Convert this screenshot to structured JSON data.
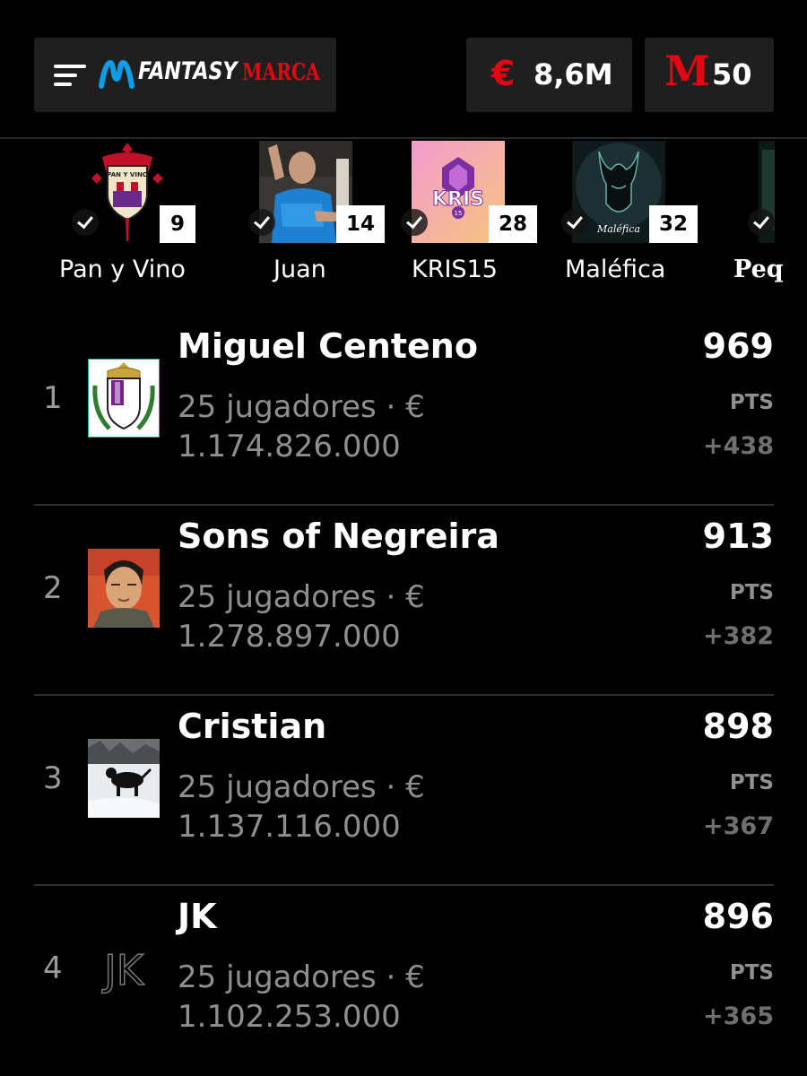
{
  "header": {
    "brand": {
      "fantasy": "FANTASY",
      "marca": "MARCA"
    },
    "money": {
      "icon": "euro-icon",
      "value": "8,6M"
    },
    "points": {
      "icon": "marca-m-icon",
      "value": "50"
    }
  },
  "carousel": {
    "teams": [
      {
        "name": "Pan y Vino",
        "badge": "9"
      },
      {
        "name": "Juan",
        "badge": "14"
      },
      {
        "name": "KRIS15",
        "badge": "28"
      },
      {
        "name": "Maléfica",
        "badge": "32"
      },
      {
        "name": "Peq",
        "badge": ""
      }
    ],
    "images": {
      "kris_text": "KRIS",
      "kris_num": "15",
      "malefica_text": "Maléfica",
      "panyvino_text": "PAN Y VINO"
    }
  },
  "ranking": [
    {
      "position": "1",
      "name": "Miguel Centeno",
      "players": "25 jugadores · €",
      "value": "1.174.826.000",
      "points": "969",
      "pts_label": "PTS",
      "delta": "+438"
    },
    {
      "position": "2",
      "name": "Sons of Negreira",
      "players": "25 jugadores · €",
      "value": "1.278.897.000",
      "points": "913",
      "pts_label": "PTS",
      "delta": "+382"
    },
    {
      "position": "3",
      "name": "Cristian",
      "players": "25 jugadores · €",
      "value": "1.137.116.000",
      "points": "898",
      "pts_label": "PTS",
      "delta": "+367"
    },
    {
      "position": "4",
      "name": "JK",
      "players": "25 jugadores · €",
      "value": "1.102.253.000",
      "points": "896",
      "pts_label": "PTS",
      "delta": "+365",
      "avatar_text": "JK"
    }
  ],
  "colors": {
    "accent": "#e30613",
    "background": "#000000",
    "panel": "#1f1f1f"
  }
}
